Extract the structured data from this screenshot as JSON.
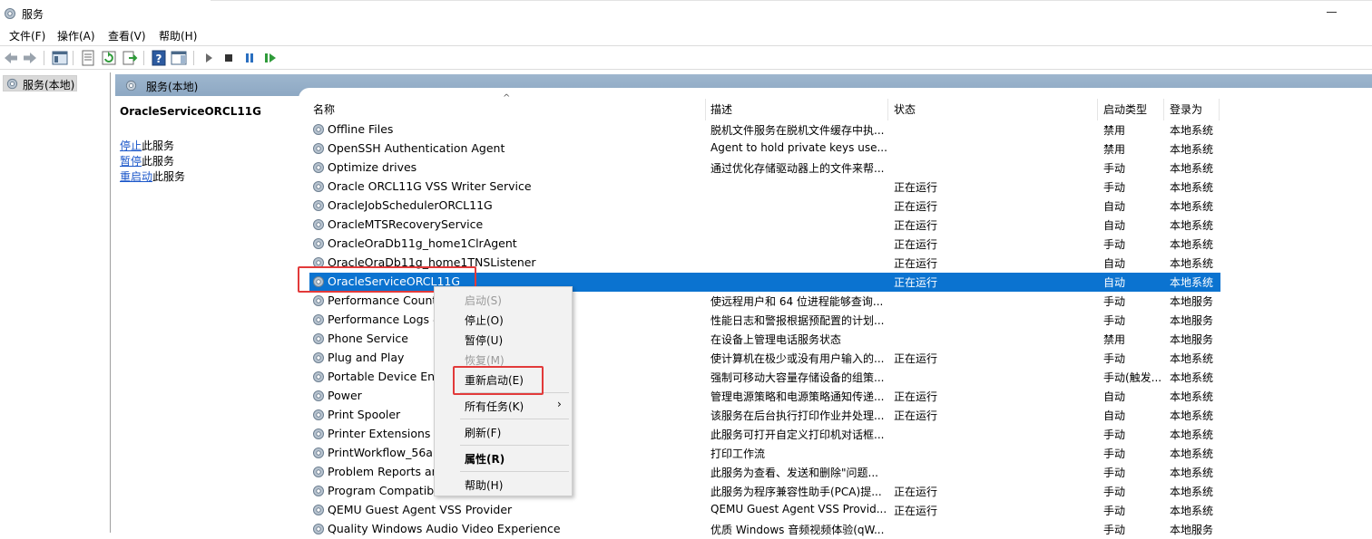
{
  "window": {
    "title": "服务"
  },
  "menu": [
    "文件(F)",
    "操作(A)",
    "查看(V)",
    "帮助(H)"
  ],
  "tree": {
    "root_label": "服务(本地)"
  },
  "panel": {
    "header": "服务(本地)"
  },
  "extended": {
    "service_name": "OracleServiceORCL11G",
    "actions": [
      {
        "link": "停止",
        "rest": "此服务"
      },
      {
        "link": "暂停",
        "rest": "此服务"
      },
      {
        "link": "重启动",
        "rest": "此服务"
      }
    ]
  },
  "table": {
    "sort_indicator": "^",
    "columns": {
      "name": "名称",
      "desc": "描述",
      "status": "状态",
      "startup": "启动类型",
      "logon": "登录为"
    },
    "rows": [
      {
        "name": "Offline Files",
        "desc": "脱机文件服务在脱机文件缓存中执...",
        "status": "",
        "startup": "禁用",
        "logon": "本地系统"
      },
      {
        "name": "OpenSSH Authentication Agent",
        "desc": "Agent to hold private keys use...",
        "status": "",
        "startup": "禁用",
        "logon": "本地系统"
      },
      {
        "name": "Optimize drives",
        "desc": "通过优化存储驱动器上的文件来帮...",
        "status": "",
        "startup": "手动",
        "logon": "本地系统"
      },
      {
        "name": "Oracle ORCL11G VSS Writer Service",
        "desc": "",
        "status": "正在运行",
        "startup": "手动",
        "logon": "本地系统"
      },
      {
        "name": "OracleJobSchedulerORCL11G",
        "desc": "",
        "status": "正在运行",
        "startup": "自动",
        "logon": "本地系统"
      },
      {
        "name": "OracleMTSRecoveryService",
        "desc": "",
        "status": "正在运行",
        "startup": "自动",
        "logon": "本地系统"
      },
      {
        "name": "OracleOraDb11g_home1ClrAgent",
        "desc": "",
        "status": "正在运行",
        "startup": "手动",
        "logon": "本地系统"
      },
      {
        "name": "OracleOraDb11g_home1TNSListener",
        "desc": "",
        "status": "正在运行",
        "startup": "自动",
        "logon": "本地系统"
      },
      {
        "name": "OracleServiceORCL11G",
        "desc": "",
        "status": "正在运行",
        "startup": "自动",
        "logon": "本地系统",
        "selected": true
      },
      {
        "name": "Performance Counte",
        "desc": "使远程用户和 64 位进程能够查询...",
        "status": "",
        "startup": "手动",
        "logon": "本地服务"
      },
      {
        "name": "Performance Logs &",
        "desc": "性能日志和警报根据预配置的计划...",
        "status": "",
        "startup": "手动",
        "logon": "本地服务"
      },
      {
        "name": "Phone Service",
        "desc": "在设备上管理电话服务状态",
        "status": "",
        "startup": "禁用",
        "logon": "本地服务"
      },
      {
        "name": "Plug and Play",
        "desc": "使计算机在极少或没有用户输入的...",
        "status": "正在运行",
        "startup": "手动",
        "logon": "本地系统"
      },
      {
        "name": "Portable Device Enu",
        "desc": "强制可移动大容量存储设备的组策...",
        "status": "",
        "startup": "手动(触发...",
        "logon": "本地系统"
      },
      {
        "name": "Power",
        "desc": "管理电源策略和电源策略通知传递...",
        "status": "正在运行",
        "startup": "自动",
        "logon": "本地系统"
      },
      {
        "name": "Print Spooler",
        "desc": "该服务在后台执行打印作业并处理...",
        "status": "正在运行",
        "startup": "自动",
        "logon": "本地系统"
      },
      {
        "name": "Printer Extensions ar",
        "desc": "此服务可打开自定义打印机对话框...",
        "status": "",
        "startup": "手动",
        "logon": "本地系统"
      },
      {
        "name": "PrintWorkflow_56a1",
        "desc": "打印工作流",
        "status": "",
        "startup": "手动",
        "logon": "本地系统"
      },
      {
        "name": "Problem Reports an                                    Support",
        "desc": "此服务为查看、发送和删除\"问题...",
        "status": "",
        "startup": "手动",
        "logon": "本地系统"
      },
      {
        "name": "Program Compatibi",
        "desc": "此服务为程序兼容性助手(PCA)提...",
        "status": "正在运行",
        "startup": "手动",
        "logon": "本地系统"
      },
      {
        "name": "QEMU Guest Agent VSS Provider",
        "desc": "QEMU Guest Agent VSS Provid...",
        "status": "正在运行",
        "startup": "手动",
        "logon": "本地系统"
      },
      {
        "name": "Quality Windows Audio Video Experience",
        "desc": "优质 Windows 音频视频体验(qW...",
        "status": "",
        "startup": "手动",
        "logon": "本地服务"
      }
    ]
  },
  "context_menu": {
    "items": [
      {
        "label": "启动(S)",
        "disabled": true
      },
      {
        "label": "停止(O)"
      },
      {
        "label": "暂停(U)"
      },
      {
        "label": "恢复(M)",
        "disabled": true
      },
      {
        "label": "重新启动(E)"
      },
      {
        "label": "所有任务(K)",
        "submenu": true
      },
      {
        "label": "刷新(F)"
      },
      {
        "label": "属性(R)",
        "bold": true
      },
      {
        "label": "帮助(H)"
      }
    ],
    "submenu_arrow": "›"
  },
  "colors": {
    "selection": "#0b73d0",
    "highlight_box": "#e23a3a",
    "link": "#1a56c9"
  }
}
